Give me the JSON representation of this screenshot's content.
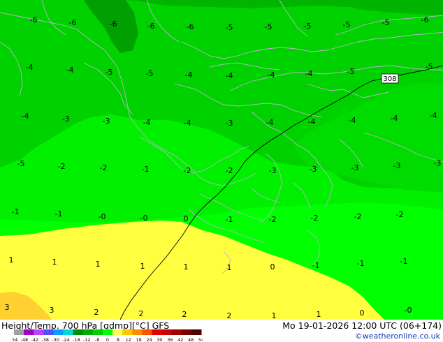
{
  "footer": {
    "title": "Height/Temp. 700 hPa [gdmp][°C] GFS",
    "valid": "Mo 19-01-2026 12:00 UTC (06+174)",
    "credit": "©weatheronline.co.uk"
  },
  "legend": {
    "ticks": [
      "-54",
      "-48",
      "-42",
      "-38",
      "-30",
      "-24",
      "-18",
      "-12",
      "-8",
      "0",
      "8",
      "12",
      "18",
      "24",
      "30",
      "36",
      "42",
      "48",
      "54"
    ],
    "colors": [
      "#a0a0a0",
      "#a000c8",
      "#c040ff",
      "#5050ff",
      "#0a9dff",
      "#00dcdc",
      "#008c00",
      "#00aa00",
      "#00d200",
      "#00ff00",
      "#ffff50",
      "#ffc800",
      "#ff8c00",
      "#ff5000",
      "#e10000",
      "#c80000",
      "#a00000",
      "#780000",
      "#500000"
    ]
  },
  "map": {
    "route_marker": "308",
    "band_colors": {
      "dark_green": "#00a000",
      "mid_green": "#00c800",
      "light_green": "#00f000",
      "bright_green": "#00ff00",
      "yellow": "#ffff40",
      "orange": "#ffd030"
    },
    "isotherm_labels": [
      "-6",
      "-6",
      "-6",
      "-6",
      "-6",
      "-5",
      "-5",
      "-5",
      "-5",
      "-5",
      "-6",
      "-4",
      "-4",
      "-5",
      "-5",
      "-4",
      "-4",
      "-4",
      "-4",
      "-5",
      "-5",
      "-4",
      "-3",
      "-3",
      "-4",
      "-4",
      "-3",
      "-4",
      "-4",
      "-4",
      "-4",
      "-4",
      "-5",
      "-2",
      "-2",
      "-1",
      "-2",
      "-2",
      "-3",
      "-3",
      "-3",
      "-3",
      "-3",
      "-1",
      "-1",
      "-0",
      "-0",
      "0",
      "-1",
      "-2",
      "-2",
      "-2",
      "-2",
      "1",
      "1",
      "1",
      "1",
      "1",
      "1",
      "0",
      "-1",
      "-1",
      "-1",
      "3",
      "3",
      "2",
      "2",
      "2",
      "2",
      "1",
      "1",
      "0",
      "-0"
    ]
  }
}
